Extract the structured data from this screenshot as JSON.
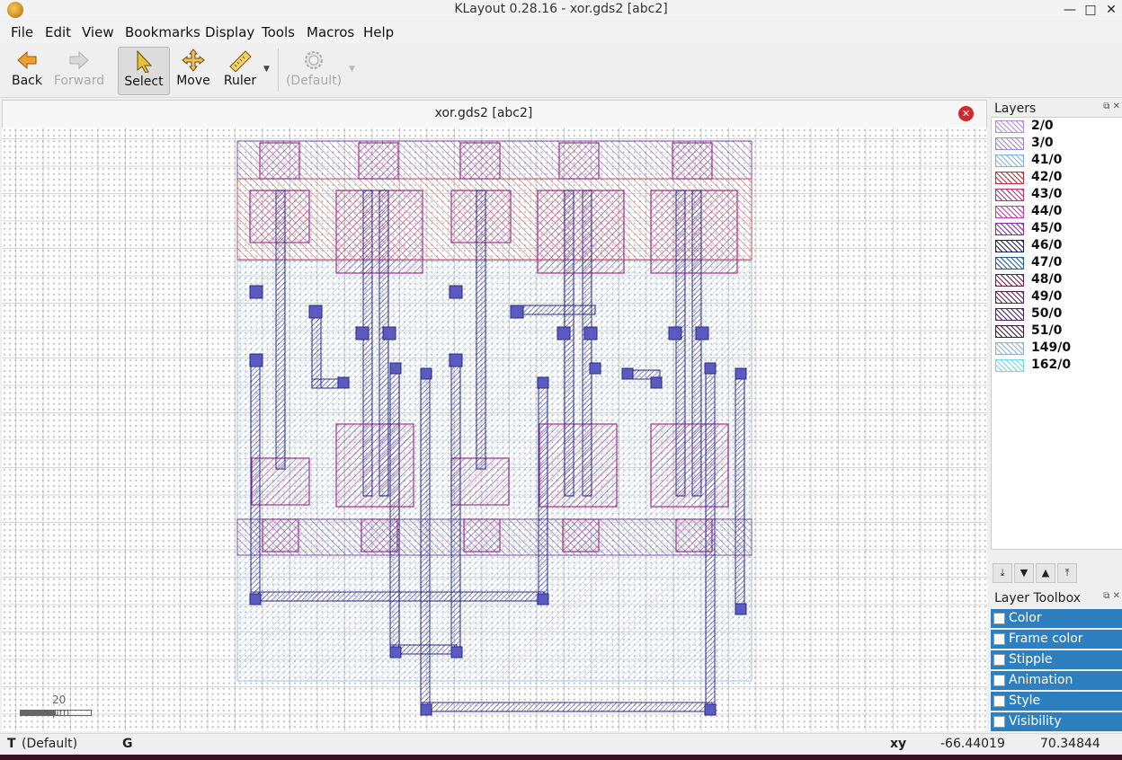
{
  "window": {
    "title": "KLayout 0.28.16 - xor.gds2 [abc2]",
    "minimize": "—",
    "maximize": "□",
    "close": "✕"
  },
  "menu": [
    "File",
    "Edit",
    "View",
    "Bookmarks",
    "Display",
    "Tools",
    "Macros",
    "Help"
  ],
  "toolbar": {
    "back": "Back",
    "forward": "Forward",
    "select": "Select",
    "move": "Move",
    "ruler": "Ruler",
    "template": "(Default)"
  },
  "document": {
    "tab_title": "xor.gds2 [abc2]",
    "scale_label": "20 µm"
  },
  "layers_panel": {
    "title": "Layers",
    "layers": [
      {
        "name": "2/0",
        "color": "#b98ad6"
      },
      {
        "name": "3/0",
        "color": "#9b8bd0"
      },
      {
        "name": "41/0",
        "color": "#7fb4e0"
      },
      {
        "name": "42/0",
        "color": "#c0303a"
      },
      {
        "name": "43/0",
        "color": "#c03070"
      },
      {
        "name": "44/0",
        "color": "#c040b0"
      },
      {
        "name": "45/0",
        "color": "#8030a0"
      },
      {
        "name": "46/0",
        "color": "#202050"
      },
      {
        "name": "47/0",
        "color": "#2060a0"
      },
      {
        "name": "48/0",
        "color": "#702040"
      },
      {
        "name": "49/0",
        "color": "#602050"
      },
      {
        "name": "50/0",
        "color": "#502070"
      },
      {
        "name": "51/0",
        "color": "#402040"
      },
      {
        "name": "149/0",
        "color": "#8fb0d0"
      },
      {
        "name": "162/0",
        "color": "#70d8e8"
      }
    ]
  },
  "layer_toolbox": {
    "title": "Layer Toolbox",
    "items": [
      "Color",
      "Frame color",
      "Stipple",
      "Animation",
      "Style",
      "Visibility"
    ]
  },
  "status": {
    "template": "(Default)",
    "grid": "G",
    "coord_label": "xy",
    "x": "-66.44019",
    "y": "70.34844"
  }
}
